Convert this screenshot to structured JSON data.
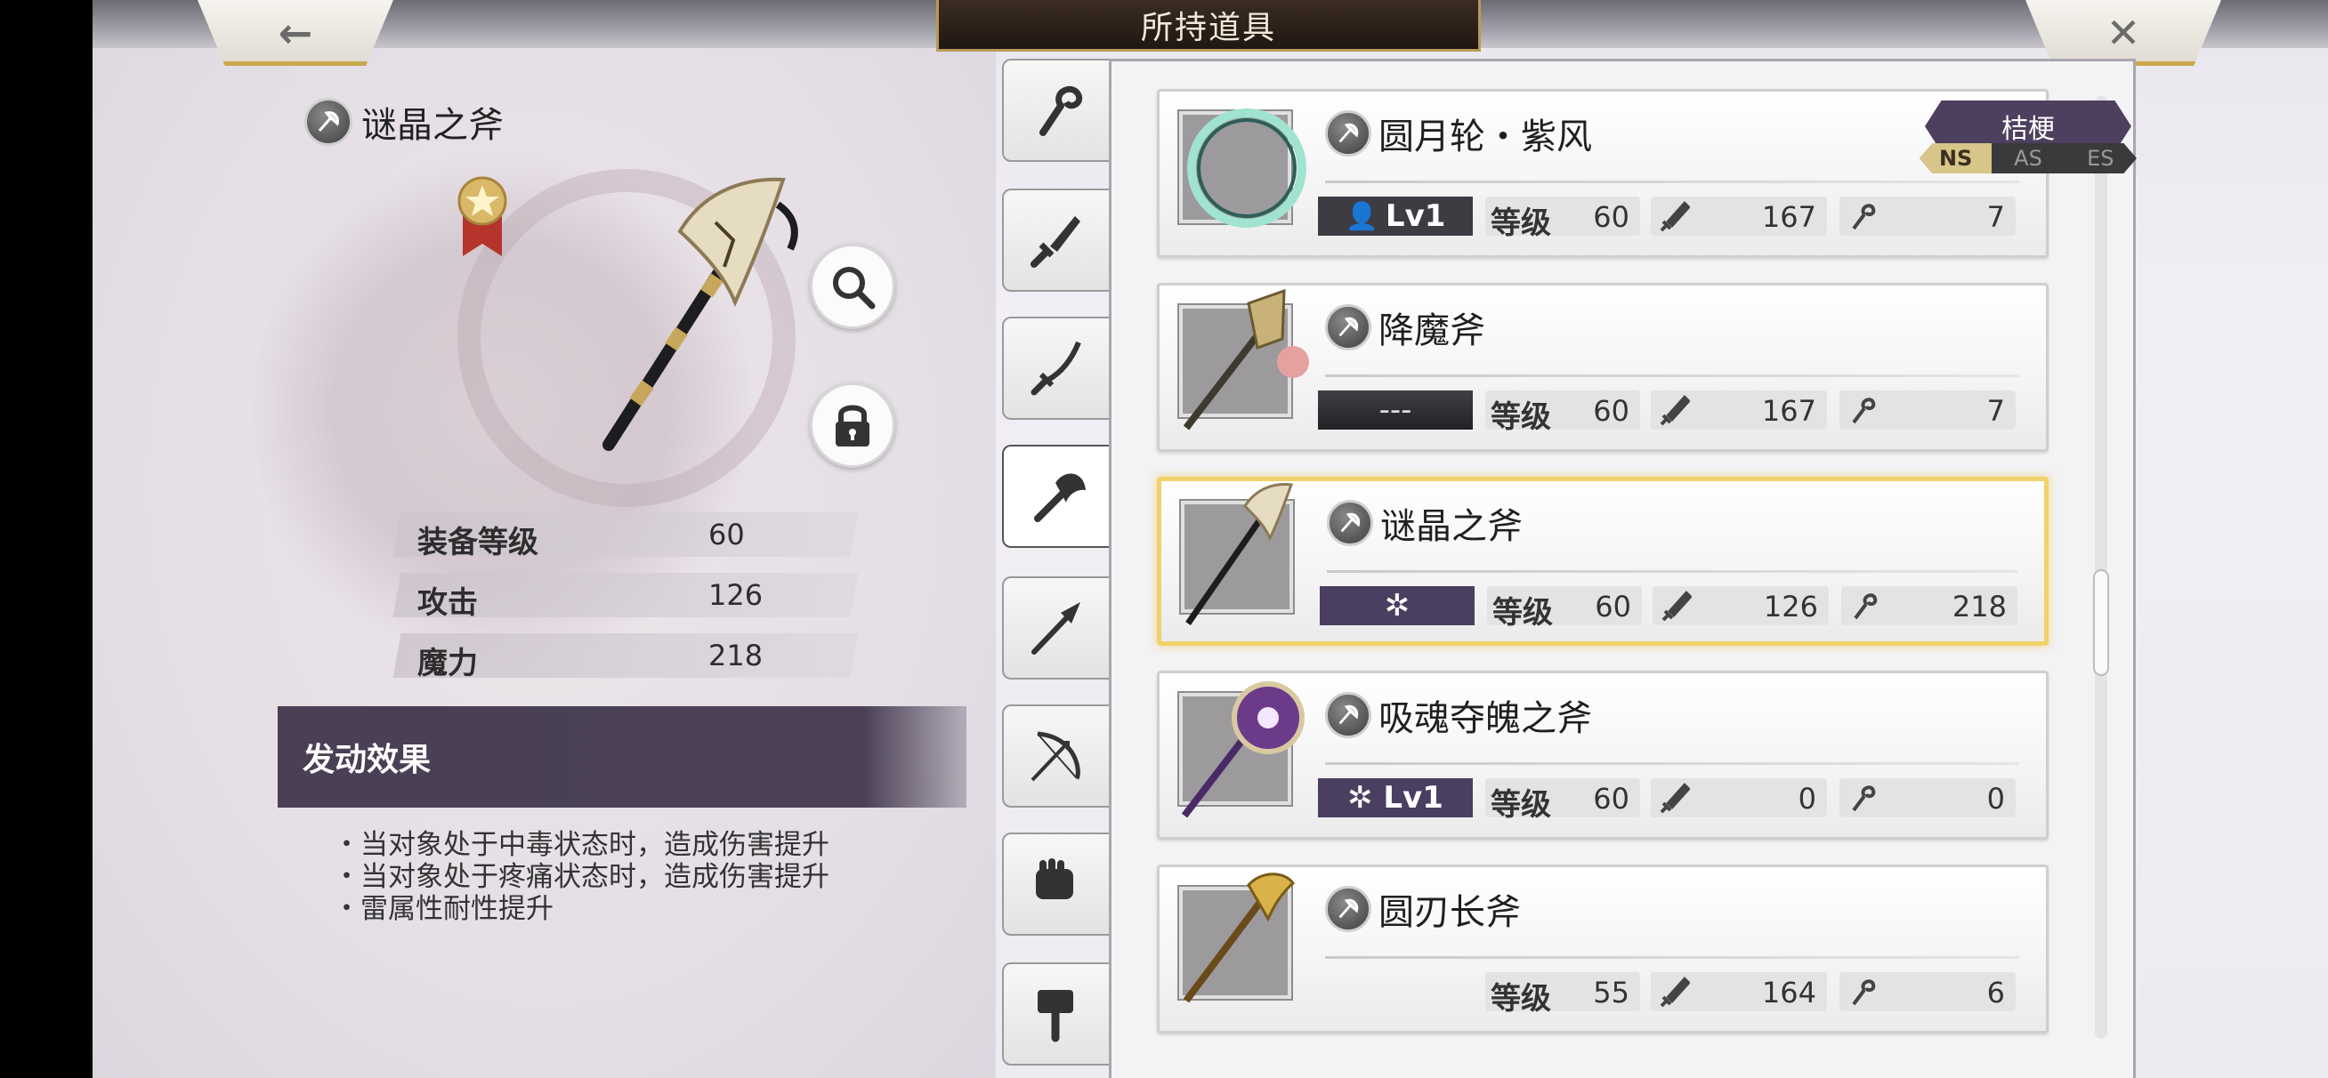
{
  "header": {
    "title": "所持道具",
    "back_icon": "←",
    "close_icon": "✕"
  },
  "detail": {
    "name": "谜晶之斧",
    "category_icon": "axe-category-icon",
    "stats": [
      {
        "label": "装备等级",
        "value": "60"
      },
      {
        "label": "攻击",
        "value": "126"
      },
      {
        "label": "魔力",
        "value": "218"
      }
    ],
    "effect_title": "发动效果",
    "effects": [
      "・当对象处于中毒状态时，造成伤害提升",
      "・当对象处于疼痛状态时，造成伤害提升",
      "・雷属性耐性提升"
    ]
  },
  "tabs": [
    "staff",
    "sword",
    "katana",
    "axe",
    "spear",
    "bow",
    "fist",
    "hammer"
  ],
  "list": {
    "rank_label": "等级",
    "items": [
      {
        "name": "圆月轮・紫风",
        "level_badge": "Lv1",
        "rank": "60",
        "atk": "167",
        "mag": "7",
        "owner": "桔梗",
        "versions": [
          "NS",
          "AS",
          "ES"
        ]
      },
      {
        "name": "降魔斧",
        "level_badge": "---",
        "rank": "60",
        "atk": "167",
        "mag": "7"
      },
      {
        "name": "谜晶之斧",
        "level_badge": "✲",
        "rank": "60",
        "atk": "126",
        "mag": "218"
      },
      {
        "name": "吸魂夺魄之斧",
        "level_badge": "✲ Lv1",
        "rank": "60",
        "atk": "0",
        "mag": "0"
      },
      {
        "name": "圆刃长斧",
        "level_badge": "",
        "rank": "55",
        "atk": "164",
        "mag": "6"
      }
    ]
  }
}
